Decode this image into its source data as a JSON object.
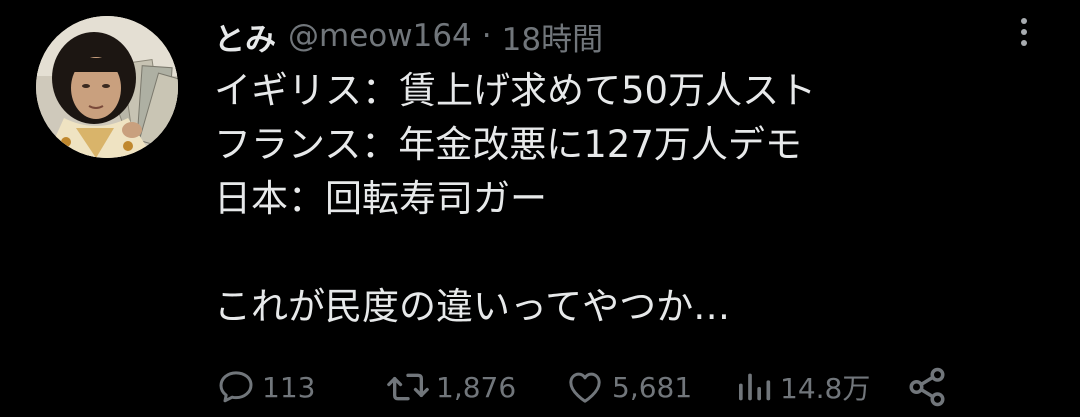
{
  "user": {
    "display_name": "とみ",
    "handle": "@meow164",
    "separator": "·",
    "time": "18時間"
  },
  "tweet": {
    "lines": [
      "イギリス：賃上げ求めて50万人スト",
      "フランス：年金改悪に127万人デモ",
      "日本：回転寿司ガー",
      "",
      "これが民度の違いってやつか…"
    ]
  },
  "actions": {
    "reply": {
      "icon": "reply-icon",
      "count": "113"
    },
    "retweet": {
      "icon": "retweet-icon",
      "count": "1,876"
    },
    "like": {
      "icon": "heart-icon",
      "count": "5,681"
    },
    "views": {
      "icon": "views-icon",
      "count": "14.8万"
    },
    "share": {
      "icon": "share-icon"
    }
  },
  "colors": {
    "background": "#000000",
    "primary_text": "#e7e9ea",
    "secondary_text": "#71767b"
  }
}
